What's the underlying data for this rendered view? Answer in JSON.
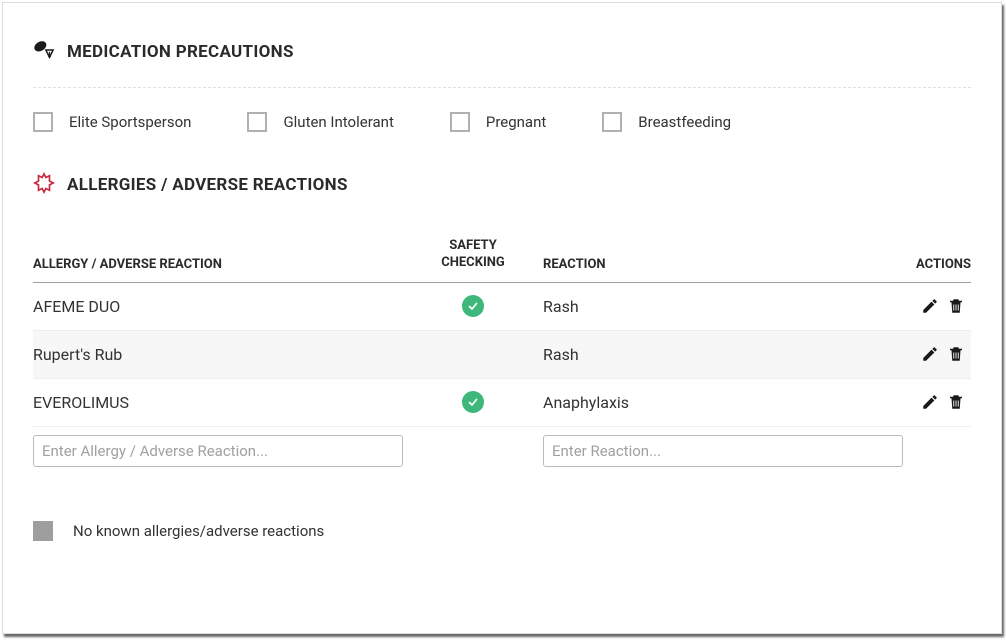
{
  "precautions": {
    "title": "MEDICATION PRECAUTIONS",
    "items": [
      {
        "label": "Elite Sportsperson"
      },
      {
        "label": "Gluten Intolerant"
      },
      {
        "label": "Pregnant"
      },
      {
        "label": "Breastfeeding"
      }
    ]
  },
  "allergies": {
    "title": "ALLERGIES / ADVERSE REACTIONS",
    "columns": {
      "allergy": "ALLERGY / ADVERSE REACTION",
      "safety": "SAFETY CHECKING",
      "reaction": "REACTION",
      "actions": "ACTIONS"
    },
    "rows": [
      {
        "allergy": "AFEME DUO",
        "safety": true,
        "reaction": "Rash"
      },
      {
        "allergy": "Rupert's Rub",
        "safety": false,
        "reaction": "Rash"
      },
      {
        "allergy": "EVEROLIMUS",
        "safety": true,
        "reaction": "Anaphylaxis"
      }
    ],
    "placeholders": {
      "allergy": "Enter Allergy / Adverse Reaction...",
      "reaction": "Enter Reaction..."
    },
    "no_known_label": "No known allergies/adverse reactions"
  }
}
